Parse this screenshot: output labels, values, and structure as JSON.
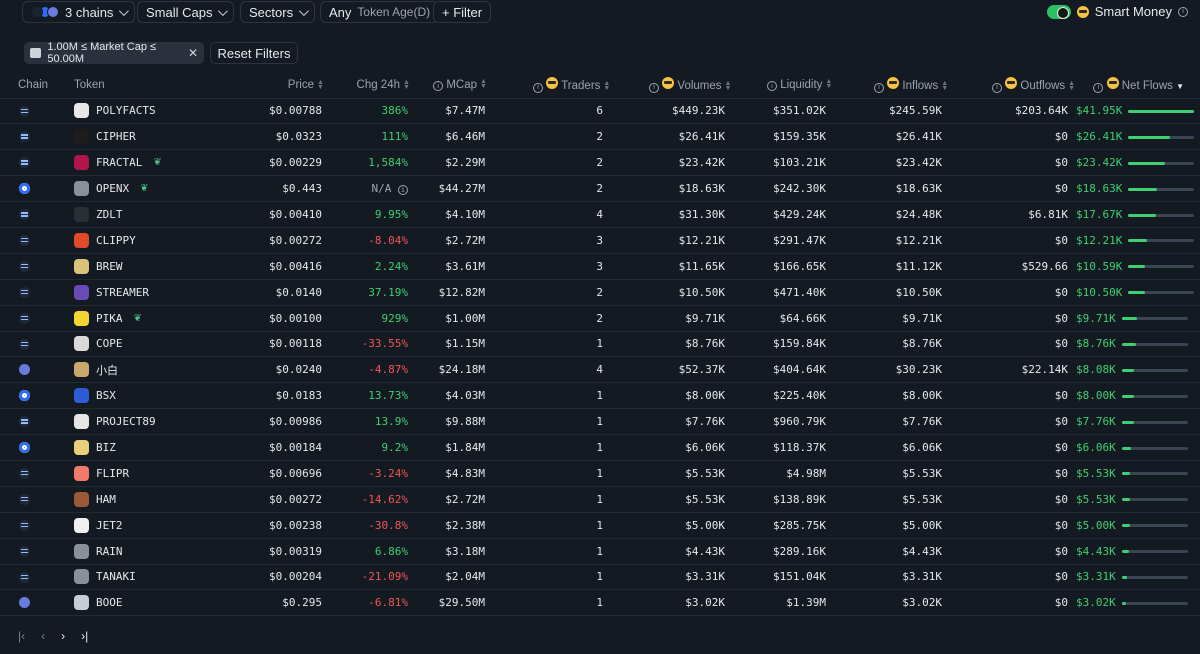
{
  "toolbar": {
    "chains_label": "3 chains",
    "small_caps_label": "Small Caps",
    "sectors_label": "Sectors",
    "any_label": "Any",
    "token_age_label": "Token Age(D)",
    "filter_label": "+ Filter",
    "smart_money_label": "Smart Money"
  },
  "filters": {
    "market_cap_tag": "1.00M ≤ Market Cap ≤ 50.00M",
    "reset_label": "Reset Filters"
  },
  "columns": {
    "chain": "Chain",
    "token": "Token",
    "price": "Price",
    "chg": "Chg 24h",
    "mcap": "MCap",
    "traders": "Traders",
    "volumes": "Volumes",
    "liquidity": "Liquidity",
    "inflows": "Inflows",
    "outflows": "Outflows",
    "netflows": "Net Flows"
  },
  "rows": [
    {
      "chain": "sol",
      "icon_color": "#e8e8e8",
      "token": "POLYFACTS",
      "leaf": false,
      "price": "$0.00788",
      "chg": "386%",
      "chg_dir": "pos",
      "mcap": "$7.47M",
      "traders": "6",
      "volumes": "$449.23K",
      "liquidity": "$351.02K",
      "inflows": "$245.59K",
      "outflows": "$203.64K",
      "net": "$41.95K",
      "net_frac": 1.0
    },
    {
      "chain": "sol",
      "icon_color": "#1d1d1d",
      "token": "CIPHER",
      "leaf": false,
      "price": "$0.0323",
      "chg": "111%",
      "chg_dir": "pos",
      "mcap": "$6.46M",
      "traders": "2",
      "volumes": "$26.41K",
      "liquidity": "$159.35K",
      "inflows": "$26.41K",
      "outflows": "$0",
      "net": "$26.41K",
      "net_frac": 0.63
    },
    {
      "chain": "sol",
      "icon_color": "#b0164b",
      "token": "FRACTAL",
      "leaf": true,
      "price": "$0.00229",
      "chg": "1,584%",
      "chg_dir": "pos",
      "mcap": "$2.29M",
      "traders": "2",
      "volumes": "$23.42K",
      "liquidity": "$103.21K",
      "inflows": "$23.42K",
      "outflows": "$0",
      "net": "$23.42K",
      "net_frac": 0.56
    },
    {
      "chain": "base",
      "icon_color": "#8a8f98",
      "token": "OPENX",
      "leaf": true,
      "price": "$0.443",
      "chg": "N/A",
      "chg_dir": "na",
      "mcap": "$44.27M",
      "traders": "2",
      "volumes": "$18.63K",
      "liquidity": "$242.30K",
      "inflows": "$18.63K",
      "outflows": "$0",
      "net": "$18.63K",
      "net_frac": 0.44
    },
    {
      "chain": "sol",
      "icon_color": "#2a2f36",
      "token": "ZDLT",
      "leaf": false,
      "price": "$0.00410",
      "chg": "9.95%",
      "chg_dir": "pos",
      "mcap": "$4.10M",
      "traders": "4",
      "volumes": "$31.30K",
      "liquidity": "$429.24K",
      "inflows": "$24.48K",
      "outflows": "$6.81K",
      "net": "$17.67K",
      "net_frac": 0.42
    },
    {
      "chain": "sol",
      "icon_color": "#e04a2a",
      "token": "CLIPPY",
      "leaf": false,
      "price": "$0.00272",
      "chg": "-8.04%",
      "chg_dir": "neg",
      "mcap": "$2.72M",
      "traders": "3",
      "volumes": "$12.21K",
      "liquidity": "$291.47K",
      "inflows": "$12.21K",
      "outflows": "$0",
      "net": "$12.21K",
      "net_frac": 0.29
    },
    {
      "chain": "sol",
      "icon_color": "#d9c27a",
      "token": "BREW",
      "leaf": false,
      "price": "$0.00416",
      "chg": "2.24%",
      "chg_dir": "pos",
      "mcap": "$3.61M",
      "traders": "3",
      "volumes": "$11.65K",
      "liquidity": "$166.65K",
      "inflows": "$11.12K",
      "outflows": "$529.66",
      "net": "$10.59K",
      "net_frac": 0.25
    },
    {
      "chain": "sol",
      "icon_color": "#6a4bb5",
      "token": "STREAMER",
      "leaf": false,
      "price": "$0.0140",
      "chg": "37.19%",
      "chg_dir": "pos",
      "mcap": "$12.82M",
      "traders": "2",
      "volumes": "$10.50K",
      "liquidity": "$471.40K",
      "inflows": "$10.50K",
      "outflows": "$0",
      "net": "$10.50K",
      "net_frac": 0.25
    },
    {
      "chain": "sol",
      "icon_color": "#f2d533",
      "token": "PIKA",
      "leaf": true,
      "price": "$0.00100",
      "chg": "929%",
      "chg_dir": "pos",
      "mcap": "$1.00M",
      "traders": "2",
      "volumes": "$9.71K",
      "liquidity": "$64.66K",
      "inflows": "$9.71K",
      "outflows": "$0",
      "net": "$9.71K",
      "net_frac": 0.23
    },
    {
      "chain": "sol",
      "icon_color": "#d9d9d9",
      "token": "COPE",
      "leaf": false,
      "price": "$0.00118",
      "chg": "-33.55%",
      "chg_dir": "neg",
      "mcap": "$1.15M",
      "traders": "1",
      "volumes": "$8.76K",
      "liquidity": "$159.84K",
      "inflows": "$8.76K",
      "outflows": "$0",
      "net": "$8.76K",
      "net_frac": 0.21
    },
    {
      "chain": "eth",
      "icon_color": "#c9a96b",
      "token": "小白",
      "leaf": false,
      "price": "$0.0240",
      "chg": "-4.87%",
      "chg_dir": "neg",
      "mcap": "$24.18M",
      "traders": "4",
      "volumes": "$52.37K",
      "liquidity": "$404.64K",
      "inflows": "$30.23K",
      "outflows": "$22.14K",
      "net": "$8.08K",
      "net_frac": 0.19
    },
    {
      "chain": "base",
      "icon_color": "#2f5bd6",
      "token": "BSX",
      "leaf": false,
      "price": "$0.0183",
      "chg": "13.73%",
      "chg_dir": "pos",
      "mcap": "$4.03M",
      "traders": "1",
      "volumes": "$8.00K",
      "liquidity": "$225.40K",
      "inflows": "$8.00K",
      "outflows": "$0",
      "net": "$8.00K",
      "net_frac": 0.19
    },
    {
      "chain": "sol",
      "icon_color": "#e5e5e5",
      "token": "PROJECT89",
      "leaf": false,
      "price": "$0.00986",
      "chg": "13.9%",
      "chg_dir": "pos",
      "mcap": "$9.88M",
      "traders": "1",
      "volumes": "$7.76K",
      "liquidity": "$960.79K",
      "inflows": "$7.76K",
      "outflows": "$0",
      "net": "$7.76K",
      "net_frac": 0.18
    },
    {
      "chain": "base",
      "icon_color": "#e8d07a",
      "token": "BIZ",
      "leaf": false,
      "price": "$0.00184",
      "chg": "9.2%",
      "chg_dir": "pos",
      "mcap": "$1.84M",
      "traders": "1",
      "volumes": "$6.06K",
      "liquidity": "$118.37K",
      "inflows": "$6.06K",
      "outflows": "$0",
      "net": "$6.06K",
      "net_frac": 0.14
    },
    {
      "chain": "sol",
      "icon_color": "#f27a6a",
      "token": "FLIPR",
      "leaf": false,
      "price": "$0.00696",
      "chg": "-3.24%",
      "chg_dir": "neg",
      "mcap": "$4.83M",
      "traders": "1",
      "volumes": "$5.53K",
      "liquidity": "$4.98M",
      "inflows": "$5.53K",
      "outflows": "$0",
      "net": "$5.53K",
      "net_frac": 0.13
    },
    {
      "chain": "sol",
      "icon_color": "#9a5a3a",
      "token": "HAM",
      "leaf": false,
      "price": "$0.00272",
      "chg": "-14.62%",
      "chg_dir": "neg",
      "mcap": "$2.72M",
      "traders": "1",
      "volumes": "$5.53K",
      "liquidity": "$138.89K",
      "inflows": "$5.53K",
      "outflows": "$0",
      "net": "$5.53K",
      "net_frac": 0.13
    },
    {
      "chain": "sol",
      "icon_color": "#f0f0f0",
      "token": "JET2",
      "leaf": false,
      "price": "$0.00238",
      "chg": "-30.8%",
      "chg_dir": "neg",
      "mcap": "$2.38M",
      "traders": "1",
      "volumes": "$5.00K",
      "liquidity": "$285.75K",
      "inflows": "$5.00K",
      "outflows": "$0",
      "net": "$5.00K",
      "net_frac": 0.12
    },
    {
      "chain": "sol",
      "icon_color": "#8a8f98",
      "token": "RAIN",
      "leaf": false,
      "price": "$0.00319",
      "chg": "6.86%",
      "chg_dir": "pos",
      "mcap": "$3.18M",
      "traders": "1",
      "volumes": "$4.43K",
      "liquidity": "$289.16K",
      "inflows": "$4.43K",
      "outflows": "$0",
      "net": "$4.43K",
      "net_frac": 0.11
    },
    {
      "chain": "sol",
      "icon_color": "#8a8f98",
      "token": "TANAKI",
      "leaf": false,
      "price": "$0.00204",
      "chg": "-21.09%",
      "chg_dir": "neg",
      "mcap": "$2.04M",
      "traders": "1",
      "volumes": "$3.31K",
      "liquidity": "$151.04K",
      "inflows": "$3.31K",
      "outflows": "$0",
      "net": "$3.31K",
      "net_frac": 0.08
    },
    {
      "chain": "eth",
      "icon_color": "#c8ccd4",
      "token": "BOOE",
      "leaf": false,
      "price": "$0.295",
      "chg": "-6.81%",
      "chg_dir": "neg",
      "mcap": "$29.50M",
      "traders": "1",
      "volumes": "$3.02K",
      "liquidity": "$1.39M",
      "inflows": "$3.02K",
      "outflows": "$0",
      "net": "$3.02K",
      "net_frac": 0.07
    }
  ],
  "pager": {
    "first": "|‹",
    "prev": "‹",
    "next": "›",
    "last": "›|"
  },
  "colors": {
    "positive": "#3ecf72",
    "negative": "#f05656",
    "background": "#141a22"
  }
}
